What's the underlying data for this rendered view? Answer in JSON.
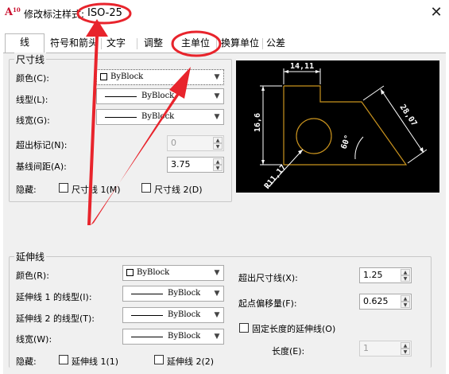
{
  "window": {
    "title_prefix": "修改标注样式:",
    "style_name": "ISO-25",
    "close_glyph": "✕",
    "app_icon_text": "A",
    "app_icon_sup": "10"
  },
  "tabs": [
    {
      "label": "线",
      "active": true
    },
    {
      "label": "符号和箭头",
      "active": false
    },
    {
      "label": "文字",
      "active": false
    },
    {
      "label": "调整",
      "active": false
    },
    {
      "label": "主单位",
      "active": false
    },
    {
      "label": "换算单位",
      "active": false
    },
    {
      "label": "公差",
      "active": false
    }
  ],
  "dim_lines": {
    "group_title": "尺寸线",
    "color_label": "颜色(C):",
    "color_value": "ByBlock",
    "linetype_label": "线型(L):",
    "linetype_value": "ByBlock",
    "lineweight_label": "线宽(G):",
    "lineweight_value": "ByBlock",
    "extend_label": "超出标记(N):",
    "extend_value": "0",
    "baseline_label": "基线间距(A):",
    "baseline_value": "3.75",
    "suppress_label": "隐藏:",
    "suppress_1": "尺寸线 1(M)",
    "suppress_2": "尺寸线 2(D)"
  },
  "ext_lines": {
    "group_title": "延伸线",
    "color_label": "颜色(R):",
    "color_value": "ByBlock",
    "lt1_label": "延伸线 1 的线型(I):",
    "lt1_value": "ByBlock",
    "lt2_label": "延伸线 2 的线型(T):",
    "lt2_value": "ByBlock",
    "lw_label": "线宽(W):",
    "lw_value": "ByBlock",
    "suppress_label": "隐藏:",
    "suppress_1": "延伸线 1(1)",
    "suppress_2": "延伸线 2(2)",
    "beyond_label": "超出尺寸线(X):",
    "beyond_value": "1.25",
    "offset_label": "起点偏移量(F):",
    "offset_value": "0.625",
    "fixed_label": "固定长度的延伸线(O)",
    "length_label": "长度(E):",
    "length_value": "1"
  },
  "preview": {
    "dim_top": "14,11",
    "dim_left": "16,6",
    "dim_right": "28,07",
    "dim_angle": "60°",
    "dim_radius": "R11,17"
  },
  "colors": {
    "annotation_red": "#e8242c",
    "preview_bg": "#000000",
    "preview_geometry": "#c8921e",
    "preview_dims": "#ffffff"
  }
}
